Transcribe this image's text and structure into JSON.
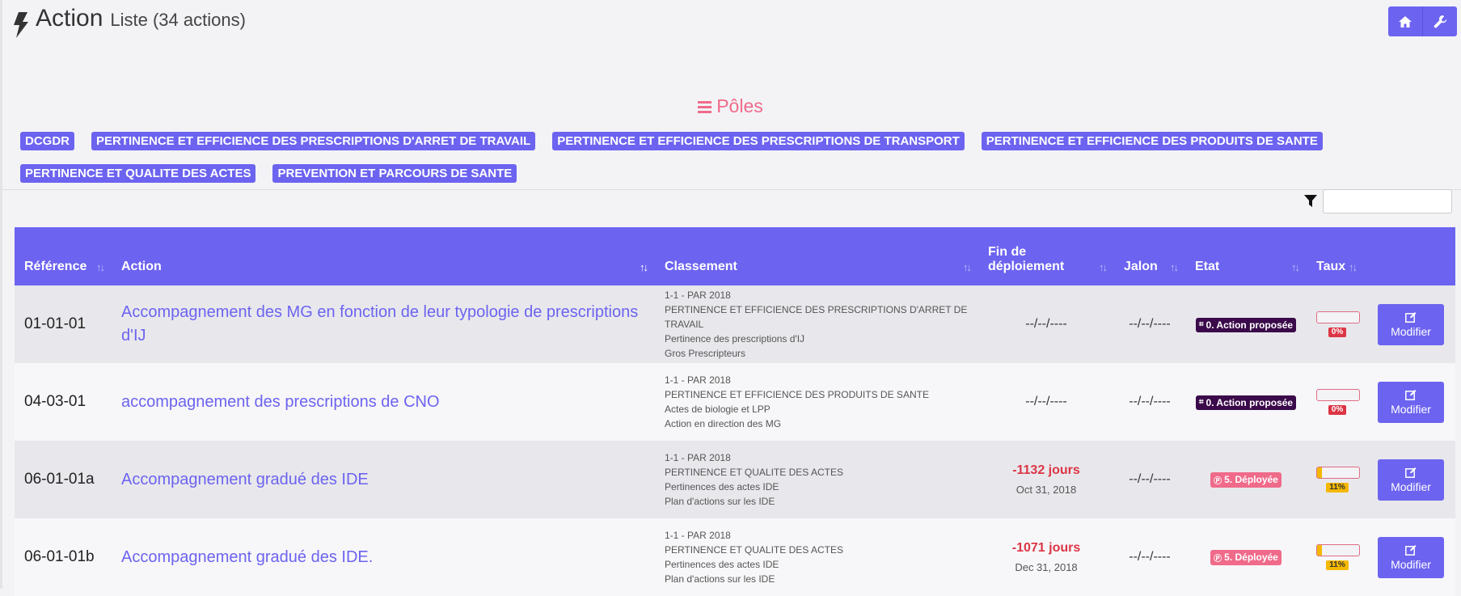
{
  "header": {
    "title": "Action",
    "subtitle": "Liste (34 actions)"
  },
  "top_buttons": [
    {
      "icon": "home-icon"
    },
    {
      "icon": "wrench-icon"
    }
  ],
  "poles": {
    "heading": "Pôles",
    "items": [
      "DCGDR",
      "PERTINENCE ET EFFICIENCE DES PRESCRIPTIONS D'ARRET DE TRAVAIL",
      "PERTINENCE ET EFFICIENCE DES PRESCRIPTIONS DE TRANSPORT",
      "PERTINENCE ET EFFICIENCE DES PRODUITS DE SANTE",
      "PERTINENCE ET QUALITE DES ACTES",
      "PREVENTION ET PARCOURS DE SANTE"
    ]
  },
  "filter": {
    "value": ""
  },
  "table": {
    "headers": {
      "reference": "Référence",
      "action": "Action",
      "classement": "Classement",
      "fin_line1": "Fin de",
      "fin_line2": "déploiement",
      "jalon": "Jalon",
      "etat": "Etat",
      "taux": "Taux"
    },
    "sort_icon": "↑↓",
    "rows": [
      {
        "reference": "01-01-01",
        "action": "Accompagnement des MG en fonction de leur typologie de prescriptions d'IJ",
        "classement": [
          "1-1 - PAR 2018",
          "PERTINENCE ET EFFICIENCE DES PRESCRIPTIONS D'ARRET DE TRAVAIL",
          "Pertinence des prescriptions d'IJ",
          "Gros Prescripteurs"
        ],
        "fin_main": "--/--/----",
        "fin_date": "",
        "jalon": "--/--/----",
        "etat": "0. Action proposée",
        "etat_icon": "file-icon",
        "etat_color": "#3b0a4a",
        "taux_value": 0,
        "taux_label": "0%",
        "taux_color": "#dc3545",
        "modify": "Modifier"
      },
      {
        "reference": "04-03-01",
        "action": "accompagnement des prescriptions de CNO",
        "classement": [
          "1-1 - PAR 2018",
          "PERTINENCE ET EFFICIENCE DES PRODUITS DE SANTE",
          "Actes de biologie et LPP",
          "Action en direction des MG"
        ],
        "fin_main": "--/--/----",
        "fin_date": "",
        "jalon": "--/--/----",
        "etat": "0. Action proposée",
        "etat_icon": "file-icon",
        "etat_color": "#3b0a4a",
        "taux_value": 0,
        "taux_label": "0%",
        "taux_color": "#dc3545",
        "modify": "Modifier"
      },
      {
        "reference": "06-01-01a",
        "action": "Accompagnement gradué des IDE",
        "classement": [
          "1-1 - PAR 2018",
          "PERTINENCE ET QUALITE DES ACTES",
          "Pertinences des actes IDE",
          "Plan d'actions sur les IDE"
        ],
        "fin_main": "-1132 jours",
        "fin_date": "Oct 31, 2018",
        "jalon": "--/--/----",
        "etat": "5. Déployée",
        "etat_icon": "circle-p-icon",
        "etat_color": "#f06a8a",
        "taux_value": 11,
        "taux_label": "11%",
        "taux_color": "#f5b800",
        "modify": "Modifier"
      },
      {
        "reference": "06-01-01b",
        "action": "Accompagnement gradué des IDE.",
        "classement": [
          "1-1 - PAR 2018",
          "PERTINENCE ET QUALITE DES ACTES",
          "Pertinences des actes IDE",
          "Plan d'actions sur les IDE"
        ],
        "fin_main": "-1071 jours",
        "fin_date": "Dec 31, 2018",
        "jalon": "--/--/----",
        "etat": "5. Déployée",
        "etat_icon": "circle-p-icon",
        "etat_color": "#f06a8a",
        "taux_value": 11,
        "taux_label": "11%",
        "taux_color": "#f5b800",
        "modify": "Modifier"
      }
    ]
  },
  "colors": {
    "primary": "#6c63f0",
    "danger": "#dc3545",
    "warning": "#f5b800",
    "pink": "#f06a8a",
    "dark_purple": "#3b0a4a"
  }
}
